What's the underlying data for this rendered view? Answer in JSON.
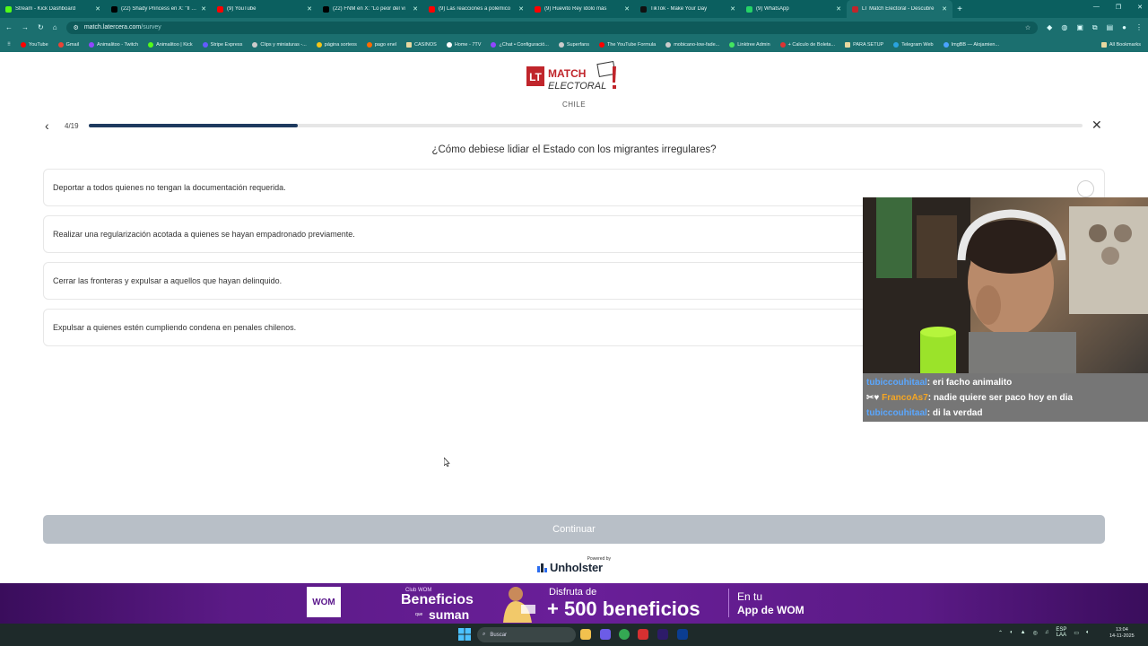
{
  "browser": {
    "tabs": [
      {
        "title": "Stream - Kick Dashboard",
        "color": "#53fc18"
      },
      {
        "title": "(22) Shady Princess en X: \"Il mé",
        "color": "#000000"
      },
      {
        "title": "(9) YouTube",
        "color": "#ff0000"
      },
      {
        "title": "(22) FNM en X: \"Lo peor del vi",
        "color": "#000000"
      },
      {
        "title": "(9) Las reacciones a polémico",
        "color": "#ff0000"
      },
      {
        "title": "(9) Huevito Rey ídolo más",
        "color": "#ff0000"
      },
      {
        "title": "TikTok - Make Your Day",
        "color": "#111111"
      },
      {
        "title": "(9) WhatsApp",
        "color": "#25d366"
      },
      {
        "title": "LT Match Electoral - Descubre",
        "color": "#c0252b"
      }
    ],
    "url_host": "match.latercera.com",
    "url_path": "/survey",
    "bookmarks": [
      "YouTube",
      "Gmail",
      "Animalitoo - Twitch",
      "Animalitoo | Kick",
      "Stripe Express",
      "Clips y miniaturas -...",
      "página sorteos",
      "pago enel",
      "CASINOS",
      "Home - 7TV",
      "¿Chat • Configuració...",
      "Superfans",
      "The YouTube Formula",
      "mobicano-low-fade...",
      "Linktree Admin",
      "+ Calculo de Boleta...",
      "PARA SETUP",
      "Telegram Web",
      "ImgBB — Alojamien..."
    ],
    "all_bookmarks": "All Bookmarks"
  },
  "survey": {
    "logo_lt": "LT",
    "logo_match": "MATCH",
    "logo_electoral": "ELECTORAL",
    "country": "CHILE",
    "counter": "4/19",
    "progress": 0.21,
    "question": "¿Cómo debiese lidiar el Estado con los migrantes irregulares?",
    "options": [
      "Deportar a todos quienes no tengan la documentación requerida.",
      "Realizar una regularización acotada a quienes se hayan empadronado previamente.",
      "Cerrar las fronteras y expulsar a aquellos que hayan delinquido.",
      "Expulsar a quienes estén cumpliendo condena en penales chilenos."
    ],
    "continue_label": "Continuar",
    "powered_by": "Powered by",
    "powered_brand": "Unholster"
  },
  "banner": {
    "brand": "WOM",
    "club": "Club WOM",
    "beneficios": "Beneficios",
    "que": "que",
    "suman": "suman",
    "disfruta": "Disfruta de",
    "offer": "+ 500 beneficios",
    "en_tu": "En tu",
    "app": "App de WOM"
  },
  "stream_chat": [
    {
      "user": "tubiccouhitaal",
      "message": ": eri facho animalito",
      "user_color": "#5aa7ff"
    },
    {
      "user": "FrancoAs7",
      "message": ": nadie quiere ser paco hoy en dia",
      "user_color": "#f5a623"
    },
    {
      "user": "tubiccouhitaal",
      "message": ": di la verdad",
      "user_color": "#5aa7ff"
    }
  ],
  "taskbar": {
    "search_placeholder": "Buscar",
    "lang": "ESP",
    "lang2": "LAA",
    "time": "13:04",
    "date": "14-11-2025"
  }
}
